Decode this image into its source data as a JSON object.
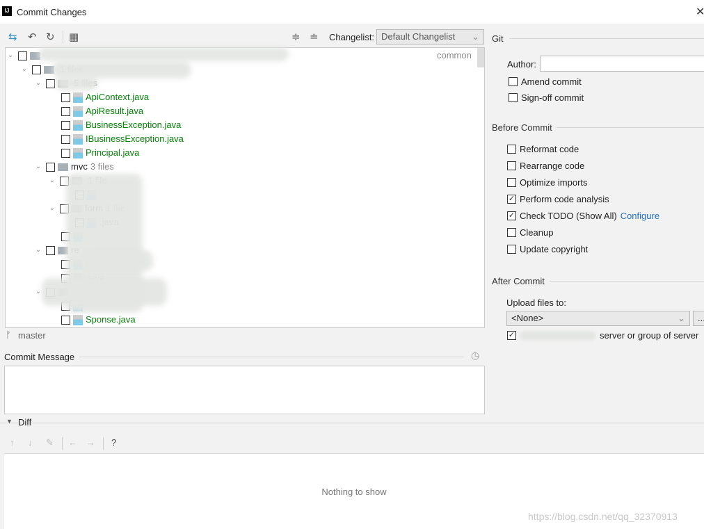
{
  "window": {
    "title": "Commit Changes"
  },
  "toolbar": {
    "changelist_label": "Changelist:",
    "changelist_value": "Default Changelist"
  },
  "tree": {
    "rows": [
      {
        "level": 0,
        "type": "folder",
        "name": "",
        "suffix": "common"
      },
      {
        "level": 1,
        "type": "folder",
        "name": "",
        "count": "1 files"
      },
      {
        "level": 2,
        "type": "folder",
        "name": "",
        "count": "5 files"
      },
      {
        "level": 3,
        "type": "file",
        "name": "ApiContext.java"
      },
      {
        "level": 3,
        "type": "file",
        "name": "ApiResult.java"
      },
      {
        "level": 3,
        "type": "file",
        "name": "BusinessException.java"
      },
      {
        "level": 3,
        "type": "file",
        "name": "IBusinessException.java"
      },
      {
        "level": 3,
        "type": "file",
        "name": "Principal.java"
      },
      {
        "level": 2,
        "type": "folder",
        "name": "mvc",
        "count": "3 files"
      },
      {
        "level": 3,
        "type": "folder",
        "name": "",
        "count": "1 file"
      },
      {
        "level": 4,
        "type": "file",
        "name": ""
      },
      {
        "level": 3,
        "type": "folder",
        "name": "form",
        "count": "1 file"
      },
      {
        "level": 4,
        "type": "file",
        "name": ".java"
      },
      {
        "level": 3,
        "type": "file",
        "name": ""
      },
      {
        "level": 2,
        "type": "folder",
        "name": "re",
        "count": ""
      },
      {
        "level": 3,
        "type": "file",
        "name": "B.java"
      },
      {
        "level": 3,
        "type": "file",
        "name": ".java"
      },
      {
        "level": 2,
        "type": "folder",
        "name": "onse",
        "count": "2 files"
      },
      {
        "level": 3,
        "type": "file",
        "name": ""
      },
      {
        "level": 3,
        "type": "file",
        "name": "Sponse.java"
      }
    ]
  },
  "branch": "master",
  "commit_message": {
    "label": "Commit Message",
    "value": ""
  },
  "git": {
    "header": "Git",
    "author_label": "Author:",
    "author_value": "",
    "amend": "Amend commit",
    "signoff": "Sign-off commit"
  },
  "before_commit": {
    "header": "Before Commit",
    "options": [
      {
        "label": "Reformat code",
        "checked": false
      },
      {
        "label": "Rearrange code",
        "checked": false
      },
      {
        "label": "Optimize imports",
        "checked": false
      },
      {
        "label": "Perform code analysis",
        "checked": true
      },
      {
        "label": "Check TODO (Show All)",
        "checked": true,
        "link": "Configure"
      },
      {
        "label": "Cleanup",
        "checked": false
      },
      {
        "label": "Update copyright",
        "checked": false
      }
    ]
  },
  "after_commit": {
    "header": "After Commit",
    "upload_label": "Upload files to:",
    "upload_value": "<None>",
    "browse": "...",
    "server_text": "server or group of server"
  },
  "diff": {
    "label": "Diff",
    "empty": "Nothing to show",
    "help": "?"
  },
  "watermark": "https://blog.csdn.net/qq_32370913"
}
